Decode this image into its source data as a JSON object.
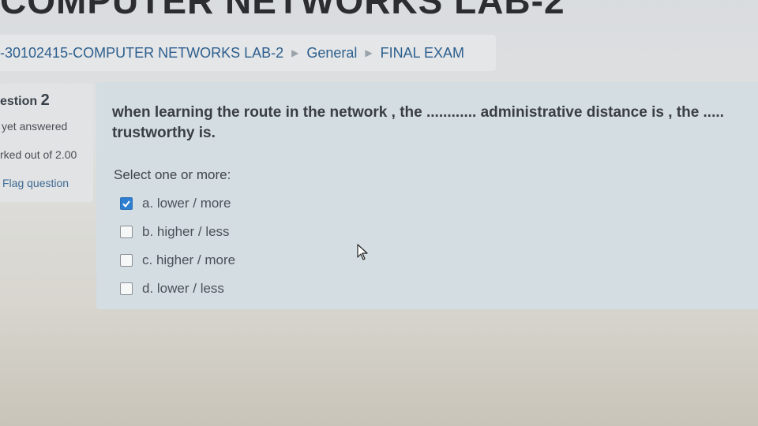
{
  "course": {
    "heading": "COMPUTER NETWORKS LAB-2"
  },
  "breadcrumb": {
    "items": [
      {
        "label": "-30102415-COMPUTER NETWORKS LAB-2"
      },
      {
        "label": "General"
      },
      {
        "label": "FINAL EXAM"
      }
    ]
  },
  "question_info": {
    "question_label": "estion",
    "question_number": "2",
    "state": "yet answered",
    "marks": "rked out of 2.00",
    "flag": "Flag question"
  },
  "question": {
    "text": "when learning the route in the network , the ............ administrative distance is , the ..... trustworthy is.",
    "prompt": "Select one or more:",
    "options": [
      {
        "label": "a. lower  / more",
        "checked": true
      },
      {
        "label": "b. higher  / less",
        "checked": false
      },
      {
        "label": "c. higher / more",
        "checked": false
      },
      {
        "label": "d. lower / less",
        "checked": false
      }
    ]
  },
  "colors": {
    "checkbox_checked": "#2f7fd0",
    "link": "#2d5f8d",
    "question_bg": "#d3dde2"
  }
}
